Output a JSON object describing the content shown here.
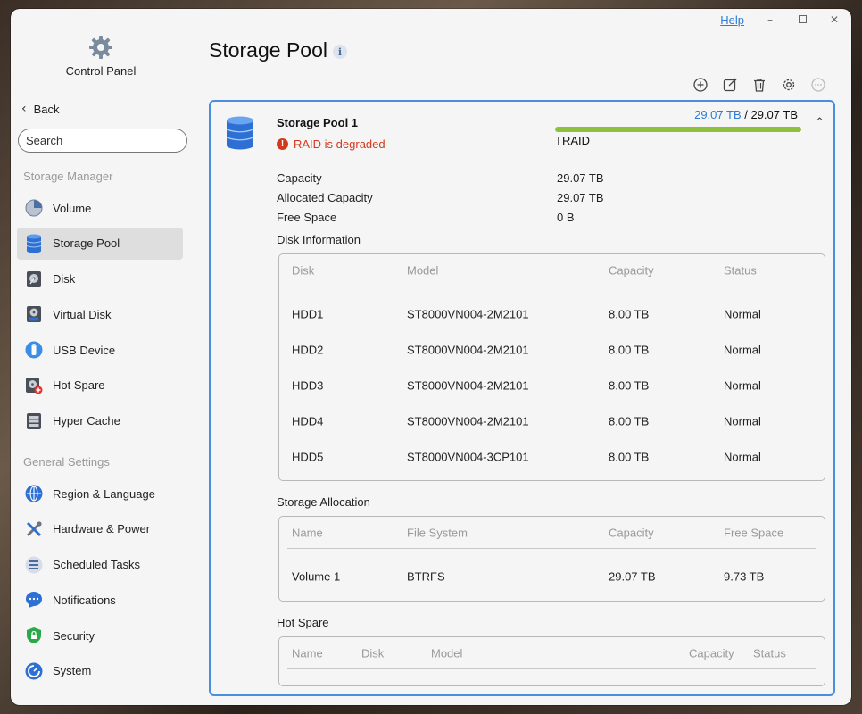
{
  "window": {
    "help_label": "Help",
    "minimize_icon": "minimize-icon",
    "maximize_icon": "maximize-icon",
    "close_icon": "close-icon"
  },
  "sidebar": {
    "app_title": "Control Panel",
    "back_label": "Back",
    "search_placeholder": "Search",
    "storage_section": "Storage Manager",
    "storage_items": [
      {
        "label": "Volume",
        "icon": "pie-volume-icon"
      },
      {
        "label": "Storage Pool",
        "icon": "database-icon",
        "active": true
      },
      {
        "label": "Disk",
        "icon": "hard-disk-icon"
      },
      {
        "label": "Virtual Disk",
        "icon": "virtual-disk-icon"
      },
      {
        "label": "USB Device",
        "icon": "usb-icon"
      },
      {
        "label": "Hot Spare",
        "icon": "hot-spare-icon"
      },
      {
        "label": "Hyper Cache",
        "icon": "hyper-cache-icon"
      }
    ],
    "general_section": "General Settings",
    "general_items": [
      {
        "label": "Region & Language",
        "icon": "globe-icon"
      },
      {
        "label": "Hardware & Power",
        "icon": "tools-icon"
      },
      {
        "label": "Scheduled Tasks",
        "icon": "tasks-icon"
      },
      {
        "label": "Notifications",
        "icon": "chat-bubble-icon"
      },
      {
        "label": "Security",
        "icon": "shield-lock-icon"
      },
      {
        "label": "System",
        "icon": "system-gauge-icon"
      }
    ]
  },
  "main": {
    "title": "Storage Pool",
    "toolbar": [
      "add-icon",
      "edit-icon",
      "delete-icon",
      "settings-icon",
      "more-icon"
    ],
    "pool": {
      "name": "Storage Pool 1",
      "status": "RAID is degraded",
      "used": "29.07 TB",
      "separator": " / ",
      "total": "29.07 TB",
      "usage_fraction": 1.0,
      "raid_type": "TRAID",
      "capacity_label": "Capacity",
      "capacity_value": "29.07 TB",
      "allocated_label": "Allocated Capacity",
      "allocated_value": "29.07 TB",
      "free_label": "Free Space",
      "free_value": "0 B",
      "status_color": "#d23a1e",
      "accent_color": "#2e7cd6",
      "bar_color": "#8dc03f"
    },
    "disk_info": {
      "heading": "Disk Information",
      "columns": [
        "Disk",
        "Model",
        "Capacity",
        "Status"
      ],
      "rows": [
        [
          "HDD1",
          "ST8000VN004-2M2101",
          "8.00 TB",
          "Normal"
        ],
        [
          "HDD2",
          "ST8000VN004-2M2101",
          "8.00 TB",
          "Normal"
        ],
        [
          "HDD3",
          "ST8000VN004-2M2101",
          "8.00 TB",
          "Normal"
        ],
        [
          "HDD4",
          "ST8000VN004-2M2101",
          "8.00 TB",
          "Normal"
        ],
        [
          "HDD5",
          "ST8000VN004-3CP101",
          "8.00 TB",
          "Normal"
        ]
      ]
    },
    "storage_allocation": {
      "heading": "Storage Allocation",
      "columns": [
        "Name",
        "File System",
        "Capacity",
        "Free Space"
      ],
      "rows": [
        [
          "Volume 1",
          "BTRFS",
          "29.07 TB",
          "9.73 TB"
        ]
      ]
    },
    "hot_spare": {
      "heading": "Hot Spare",
      "columns": [
        "Name",
        "Disk",
        "Model",
        "Capacity",
        "Status"
      ]
    }
  }
}
